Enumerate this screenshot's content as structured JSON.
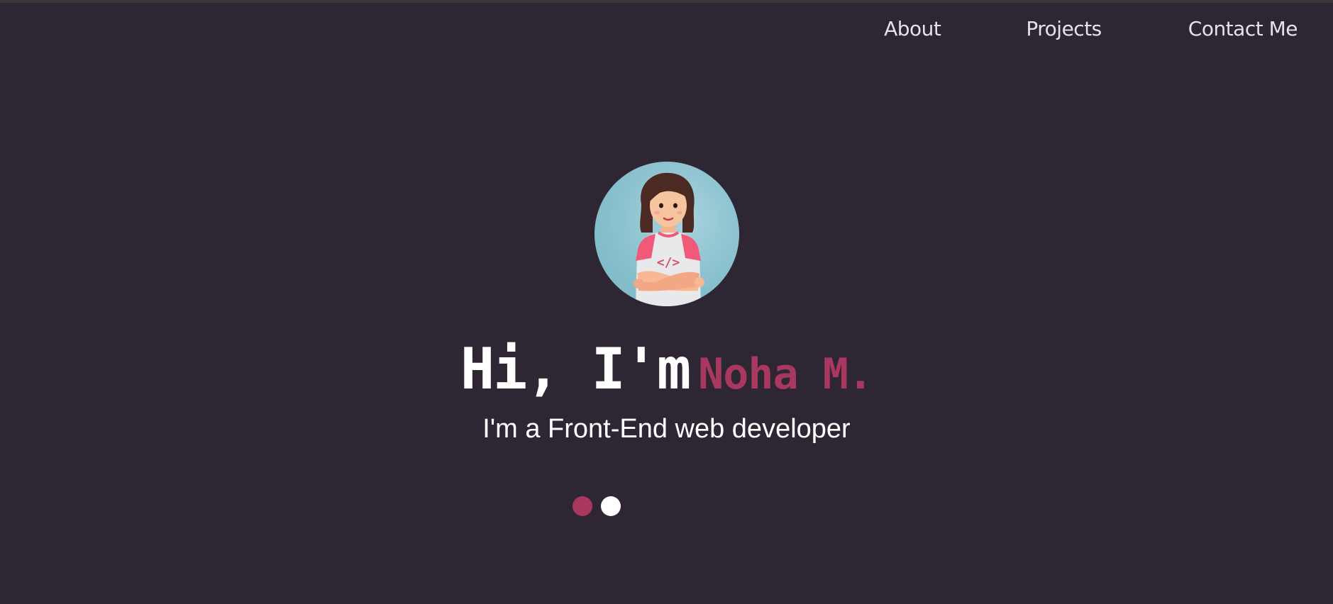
{
  "nav": {
    "items": [
      {
        "label": "About"
      },
      {
        "label": "Projects"
      },
      {
        "label": "Contact Me"
      }
    ]
  },
  "hero": {
    "avatar_alt": "developer avatar illustration",
    "greeting": "Hi, I'm",
    "name": "Noha M.",
    "subtitle": "I'm a Front-End web developer",
    "avatar_shirt_text": "</>"
  },
  "carousel": {
    "active_index": 0,
    "count": 2
  },
  "colors": {
    "background": "#2e2733",
    "accent": "#a8385f",
    "nav_text": "#e6e1ea",
    "heading_text": "#ffffff"
  }
}
